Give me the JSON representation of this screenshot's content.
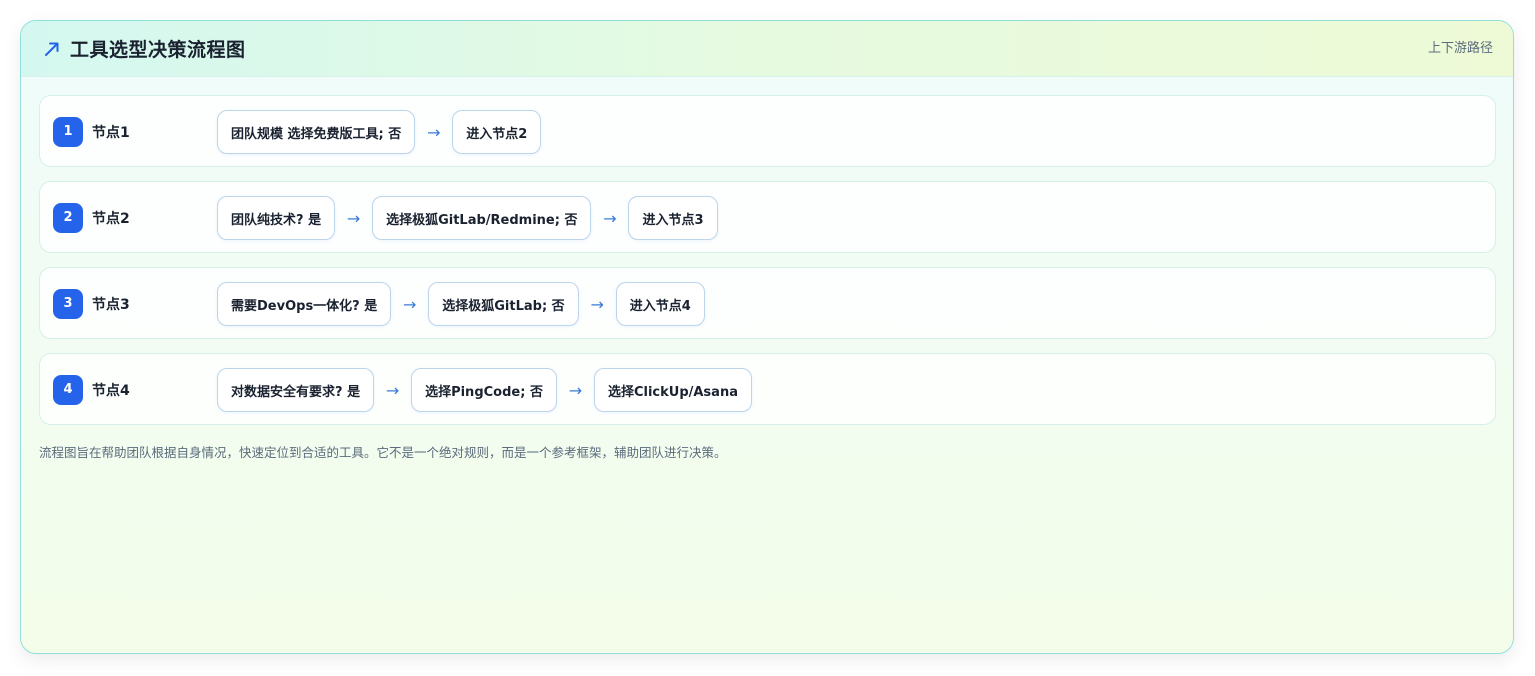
{
  "header": {
    "title": "工具选型决策流程图",
    "link": "上下游路径",
    "icon": "trend-arrow-icon",
    "accent_color": "#2563eb"
  },
  "rows": [
    {
      "number": "1",
      "label": "节点1",
      "steps": [
        "团队规模 选择免费版工具; 否",
        "进入节点2"
      ]
    },
    {
      "number": "2",
      "label": "节点2",
      "steps": [
        "团队纯技术? 是",
        "选择极狐GitLab/Redmine; 否",
        "进入节点3"
      ]
    },
    {
      "number": "3",
      "label": "节点3",
      "steps": [
        "需要DevOps一体化? 是",
        "选择极狐GitLab; 否",
        "进入节点4"
      ]
    },
    {
      "number": "4",
      "label": "节点4",
      "steps": [
        "对数据安全有要求? 是",
        "选择PingCode; 否",
        "选择ClickUp/Asana"
      ]
    }
  ],
  "arrow_glyph": "→",
  "footnote": "流程图旨在帮助团队根据自身情况，快速定位到合适的工具。它不是一个绝对规则，而是一个参考框架，辅助团队进行决策。"
}
